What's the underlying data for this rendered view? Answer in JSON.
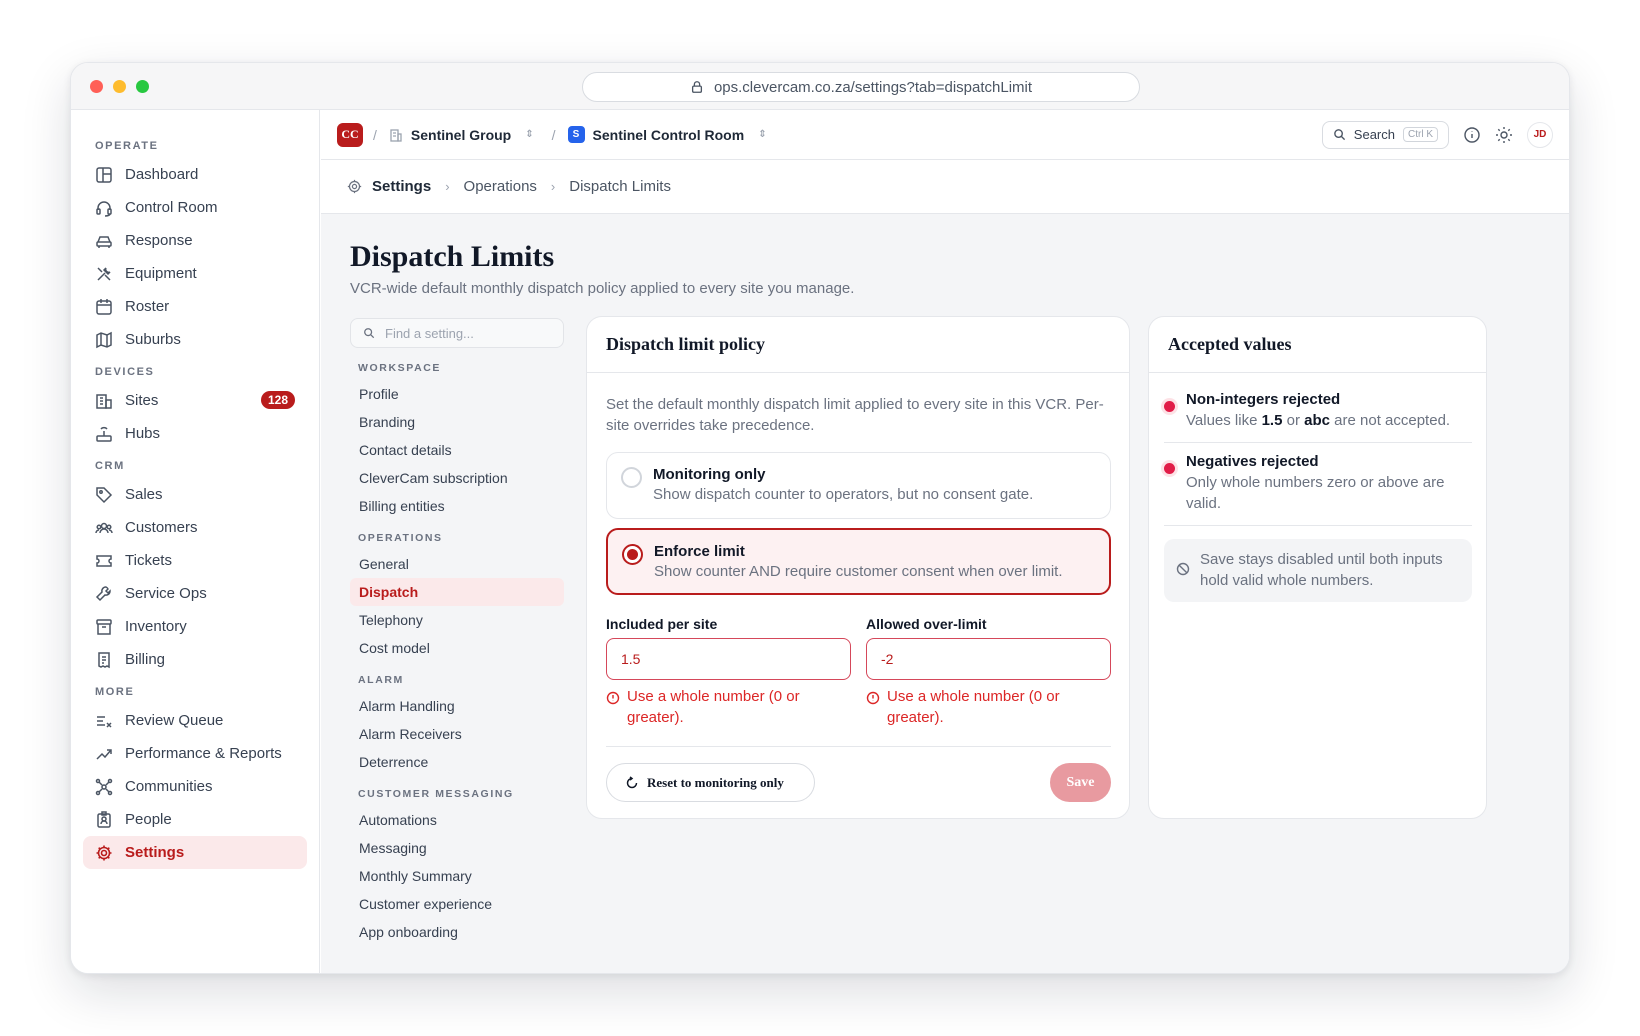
{
  "browser": {
    "url": "ops.clevercam.co.za/settings?tab=dispatchLimit"
  },
  "sidebar": {
    "sections": {
      "operate": "OPERATE",
      "devices": "DEVICES",
      "crm": "CRM",
      "more": "MORE"
    },
    "items": {
      "dashboard": "Dashboard",
      "control_room": "Control Room",
      "response": "Response",
      "equipment": "Equipment",
      "roster": "Roster",
      "suburbs": "Suburbs",
      "sites": "Sites",
      "sites_badge": "128",
      "hubs": "Hubs",
      "sales": "Sales",
      "customers": "Customers",
      "tickets": "Tickets",
      "service_ops": "Service Ops",
      "inventory": "Inventory",
      "billing": "Billing",
      "review_queue": "Review Queue",
      "performance": "Performance & Reports",
      "communities": "Communities",
      "people": "People",
      "settings": "Settings"
    }
  },
  "topbar": {
    "logo": "CC",
    "separator": "/",
    "org": "Sentinel Group",
    "room_badge": "S",
    "room": "Sentinel Control Room",
    "search_label": "Search",
    "search_shortcut": "Ctrl K",
    "avatar": "JD"
  },
  "breadcrumb": {
    "root": "Settings",
    "section": "Operations",
    "current": "Dispatch Limits"
  },
  "page": {
    "title": "Dispatch Limits",
    "subtitle": "VCR-wide default monthly dispatch policy applied to every site you manage."
  },
  "settings_nav": {
    "search_placeholder": "Find a setting...",
    "sections": {
      "workspace": "WORKSPACE",
      "operations": "OPERATIONS",
      "alarm": "ALARM",
      "customer_messaging": "CUSTOMER MESSAGING"
    },
    "items": {
      "profile": "Profile",
      "branding": "Branding",
      "contact_details": "Contact details",
      "subscription": "CleverCam subscription",
      "billing_entities": "Billing entities",
      "general": "General",
      "dispatch": "Dispatch",
      "telephony": "Telephony",
      "cost_model": "Cost model",
      "alarm_handling": "Alarm Handling",
      "alarm_receivers": "Alarm Receivers",
      "deterrence": "Deterrence",
      "automations": "Automations",
      "messaging": "Messaging",
      "monthly_summary": "Monthly Summary",
      "customer_experience": "Customer experience",
      "app_onboarding": "App onboarding"
    }
  },
  "policy_card": {
    "title": "Dispatch limit policy",
    "description": "Set the default monthly dispatch limit applied to every site in this VCR. Per-site overrides take precedence.",
    "options": [
      {
        "title": "Monitoring only",
        "desc": "Show dispatch counter to operators, but no consent gate.",
        "selected": false
      },
      {
        "title": "Enforce limit",
        "desc": "Show counter AND require customer consent when over limit.",
        "selected": true
      }
    ],
    "included": {
      "label": "Included per site",
      "value": "1.5",
      "error": "Use a whole number (0 or greater)."
    },
    "overlimit": {
      "label": "Allowed over-limit",
      "value": "-2",
      "error": "Use a whole number (0 or greater)."
    },
    "reset_label": "Reset to monitoring only",
    "save_label": "Save",
    "save_enabled": false
  },
  "accepted_card": {
    "title": "Accepted values",
    "items": [
      {
        "title": "Non-integers rejected",
        "desc_prefix": "Values like ",
        "ex1": "1.5",
        "desc_mid": " or ",
        "ex2": "abc",
        "desc_suffix": " are not accepted."
      },
      {
        "title": "Negatives rejected",
        "desc": "Only whole numbers zero or above are valid."
      }
    ],
    "note": "Save stays disabled until both inputs hold valid whole numbers."
  },
  "colors": {
    "accent": "#b91c1c",
    "error": "#dc2626",
    "save_disabled": "#e89aa0"
  }
}
